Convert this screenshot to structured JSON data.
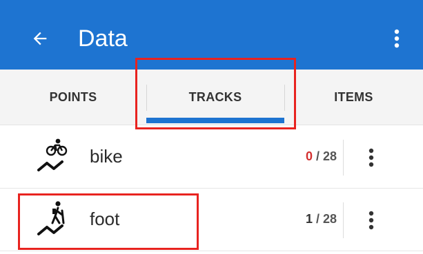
{
  "appbar": {
    "title": "Data",
    "back_icon": "arrow-left-icon",
    "menu_icon": "more-vert-icon",
    "color": "#1e74d1"
  },
  "tabs": [
    {
      "label": "POINTS",
      "selected": false
    },
    {
      "label": "TRACKS",
      "selected": true
    },
    {
      "label": "ITEMS",
      "selected": false
    }
  ],
  "rows": [
    {
      "icon": "cycling-icon",
      "label": "bike",
      "current": "0",
      "separator": " / ",
      "total": "28",
      "menu_icon": "more-vert-icon"
    },
    {
      "icon": "hiking-icon",
      "label": "foot",
      "current": "1",
      "separator": " / ",
      "total": "28",
      "menu_icon": "more-vert-icon"
    }
  ],
  "annotation_color": "#e8231f"
}
